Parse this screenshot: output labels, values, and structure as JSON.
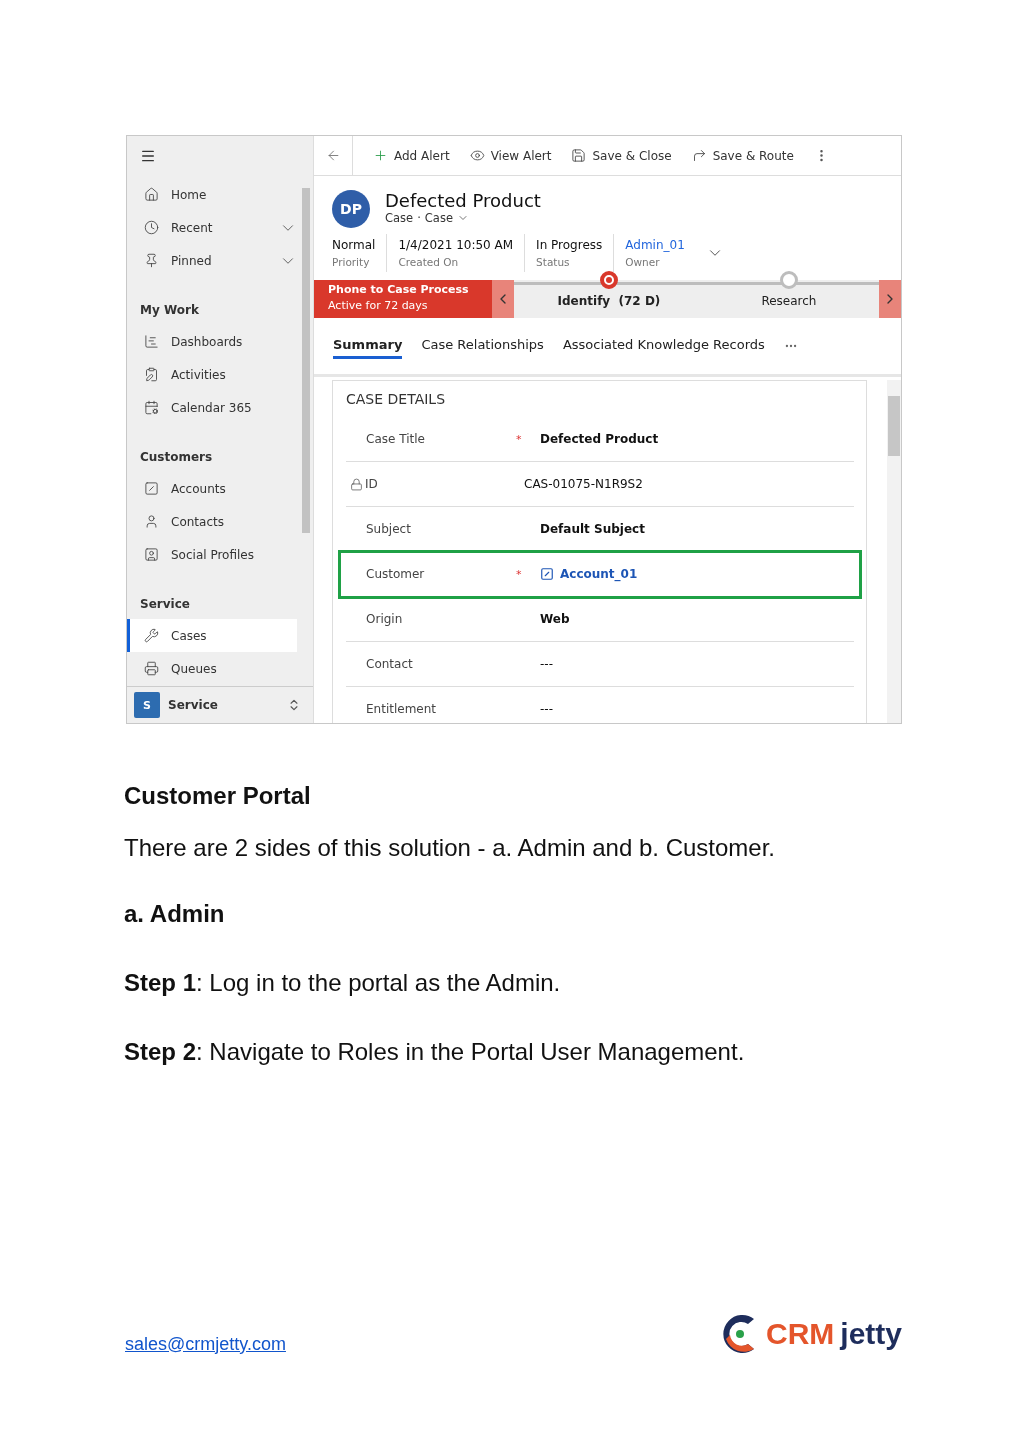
{
  "screenshot": {
    "sidebar": {
      "items": [
        {
          "kind": "nav",
          "label": "Home",
          "selected": false,
          "expandable": false
        },
        {
          "kind": "nav",
          "label": "Recent",
          "selected": false,
          "expandable": true
        },
        {
          "kind": "nav",
          "label": "Pinned",
          "selected": false,
          "expandable": true
        },
        {
          "kind": "section",
          "label": "My Work"
        },
        {
          "kind": "nav",
          "label": "Dashboards",
          "selected": false,
          "expandable": false
        },
        {
          "kind": "nav",
          "label": "Activities",
          "selected": false,
          "expandable": false
        },
        {
          "kind": "nav",
          "label": "Calendar 365",
          "selected": false,
          "expandable": false
        },
        {
          "kind": "section",
          "label": "Customers"
        },
        {
          "kind": "nav",
          "label": "Accounts",
          "selected": false,
          "expandable": false
        },
        {
          "kind": "nav",
          "label": "Contacts",
          "selected": false,
          "expandable": false
        },
        {
          "kind": "nav",
          "label": "Social Profiles",
          "selected": false,
          "expandable": false
        },
        {
          "kind": "section",
          "label": "Service"
        },
        {
          "kind": "nav",
          "label": "Cases",
          "selected": true,
          "expandable": false
        },
        {
          "kind": "nav",
          "label": "Queues",
          "selected": false,
          "expandable": false
        }
      ],
      "area_switcher": {
        "badge": "S",
        "label": "Service"
      }
    },
    "command_bar": [
      "Add Alert",
      "View Alert",
      "Save & Close",
      "Save & Route"
    ],
    "record": {
      "initials": "DP",
      "title": "Defected Product",
      "entity": "Case",
      "separator": "·",
      "form": "Case",
      "fields": [
        {
          "value": "Normal",
          "label": "Priority",
          "link": false
        },
        {
          "value": "1/4/2021 10:50 AM",
          "label": "Created On",
          "link": false
        },
        {
          "value": "In Progress",
          "label": "Status",
          "link": false
        },
        {
          "value": "Admin_01",
          "label": "Owner",
          "link": true
        }
      ]
    },
    "process": {
      "name": "Phone to Case Process",
      "duration": "Active for 72 days",
      "stages": [
        {
          "label": "Identify",
          "duration": "(72 D)",
          "active": true
        },
        {
          "label": "Research",
          "active": false
        }
      ]
    },
    "tabs": [
      {
        "label": "Summary",
        "selected": true
      },
      {
        "label": "Case Relationships",
        "selected": false
      },
      {
        "label": "Associated Knowledge Records",
        "selected": false
      }
    ],
    "section": {
      "title": "CASE DETAILS",
      "rows": [
        {
          "label": "Case Title",
          "required_mark": "*",
          "locked": false,
          "value": "Defected Product",
          "kind": "text",
          "bold": true,
          "highlighted": false
        },
        {
          "label": "ID",
          "locked": true,
          "value": "CAS-01075-N1R9S2",
          "kind": "text",
          "bold": false,
          "highlighted": false
        },
        {
          "label": "Subject",
          "locked": false,
          "value": "Default Subject",
          "kind": "text",
          "bold": true,
          "highlighted": false
        },
        {
          "label": "Customer",
          "required_mark": "*",
          "locked": false,
          "value": "Account_01",
          "kind": "lookup",
          "bold": true,
          "highlighted": true
        },
        {
          "label": "Origin",
          "locked": false,
          "value": "Web",
          "kind": "text",
          "bold": true,
          "highlighted": false
        },
        {
          "label": "Contact",
          "locked": false,
          "value": "---",
          "kind": "text",
          "bold": false,
          "highlighted": false
        },
        {
          "label": "Entitlement",
          "locked": false,
          "value": "---",
          "kind": "text",
          "bold": false,
          "highlighted": false
        }
      ]
    }
  },
  "document": {
    "heading": "Customer Portal",
    "intro": "There are 2 sides of this solution - a. Admin and b. Customer.",
    "subheading": "a. Admin",
    "steps": [
      "**Step 1**: Log in to the portal as the Admin.",
      "**Step 2**: Navigate to Roles in the Portal User Management."
    ]
  },
  "footer": {
    "email": "sales@crmjetty.com",
    "logo": {
      "part_1": "CRM",
      "part_2": "jetty"
    }
  }
}
